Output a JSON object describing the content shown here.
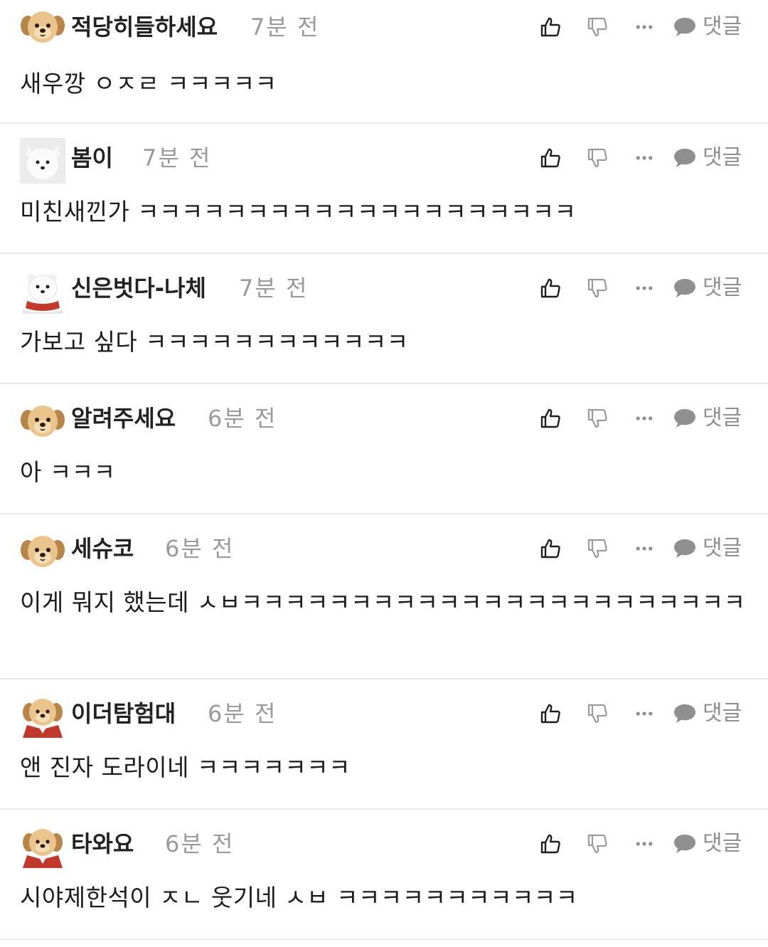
{
  "actions": {
    "reply_label": "댓글"
  },
  "comments": [
    {
      "nickname": "적당히들하세요",
      "time": "7분 전",
      "text": "새우깡 ㅇㅈㄹ ㅋㅋㅋㅋㅋ",
      "avatar": "puppy-face-icon"
    },
    {
      "nickname": "봄이",
      "time": "7분 전",
      "text": "미친새낀가 ㅋㅋㅋㅋㅋㅋㅋㅋㅋㅋㅋㅋㅋㅋㅋㅋㅋㅋㅋㅋ",
      "avatar": "white-samoyed-icon"
    },
    {
      "nickname": "신은벗다-나체",
      "time": "7분 전",
      "text": "가보고 싶다 ㅋㅋㅋㅋㅋㅋㅋㅋㅋㅋㅋㅋ",
      "avatar": "white-dog-red-scarf-icon"
    },
    {
      "nickname": "알려주세요",
      "time": "6분 전",
      "text": "아 ㅋㅋㅋ",
      "avatar": "puppy-face-icon"
    },
    {
      "nickname": "세슈코",
      "time": "6분 전",
      "text": "이게 뭐지 했는데 ㅅㅂㅋㅋㅋㅋㅋㅋㅋㅋㅋㅋㅋㅋㅋㅋㅋㅋㅋㅋㅋㅋㅋㅋㅋ",
      "avatar": "puppy-face-icon"
    },
    {
      "nickname": "이더탐험대",
      "time": "6분 전",
      "text": "앤 진자 도라이네 ㅋㅋㅋㅋㅋㅋㅋ",
      "avatar": "puppy-red-cape-icon"
    },
    {
      "nickname": "타와요",
      "time": "6분 전",
      "text": "시야제한석이 ㅈㄴ 웃기네 ㅅㅂ ㅋㅋㅋㅋㅋㅋㅋㅋㅋㅋㅋ",
      "avatar": "puppy-red-cape-icon"
    }
  ],
  "colors": {
    "nickname": "#222222",
    "time": "#9a9a9a",
    "icon": "#8f8f8f",
    "divider": "#ebebeb"
  }
}
